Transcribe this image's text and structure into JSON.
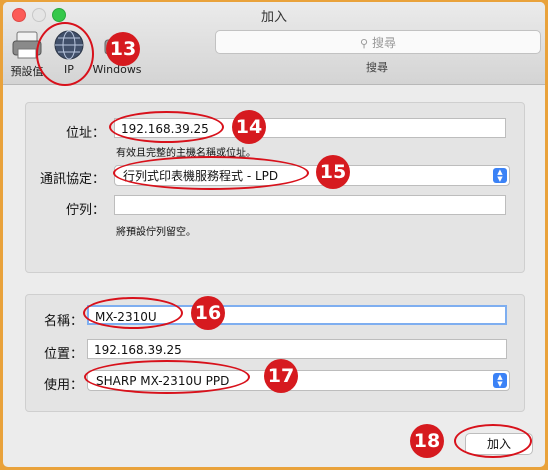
{
  "window": {
    "title": "加入"
  },
  "toolbar": {
    "items": [
      {
        "label": "預設值",
        "icon": "printer-icon"
      },
      {
        "label": "IP",
        "icon": "globe-icon"
      },
      {
        "label": "Windows",
        "icon": "windows-printer-icon"
      }
    ],
    "search": {
      "placeholder": "搜尋",
      "caption": "搜尋"
    }
  },
  "connection": {
    "address_label": "位址：",
    "address_value": "192.168.39.25",
    "address_hint": "有效且完整的主機名稱或位址。",
    "protocol_label": "通訊協定：",
    "protocol_value": "行列式印表機服務程式 - LPD",
    "queue_label": "佇列：",
    "queue_value": "",
    "queue_hint": "將預設佇列留空。"
  },
  "details": {
    "name_label": "名稱：",
    "name_value": "MX-2310U",
    "location_label": "位置：",
    "location_value": "192.168.39.25",
    "use_label": "使用：",
    "use_value": "SHARP MX-2310U PPD"
  },
  "add_button": "加入",
  "callouts": [
    "13",
    "14",
    "15",
    "16",
    "17",
    "18"
  ],
  "colors": {
    "callout": "#d61a1f",
    "frame": "#e9a23b"
  }
}
